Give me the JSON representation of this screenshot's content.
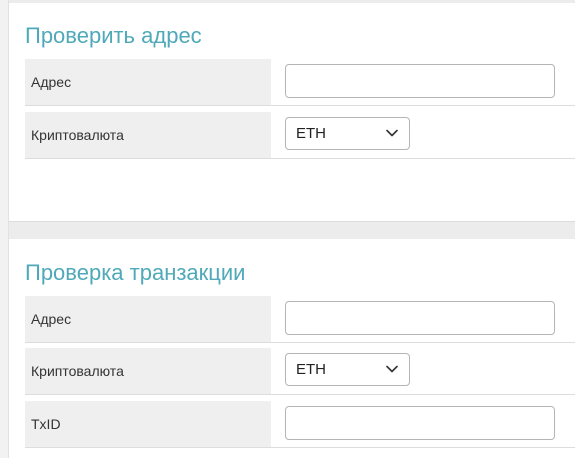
{
  "address_check": {
    "title": "Проверить адрес",
    "address_label": "Адрес",
    "address_value": "",
    "currency_label": "Криптовалюта",
    "currency_selected": "ETH"
  },
  "tx_check": {
    "title": "Проверка транзакции",
    "address_label": "Адрес",
    "address_value": "",
    "currency_label": "Криптовалюта",
    "currency_selected": "ETH",
    "txid_label": "TxID",
    "txid_value": ""
  },
  "icons": {
    "select_arrow": "chevron-down-icon"
  }
}
